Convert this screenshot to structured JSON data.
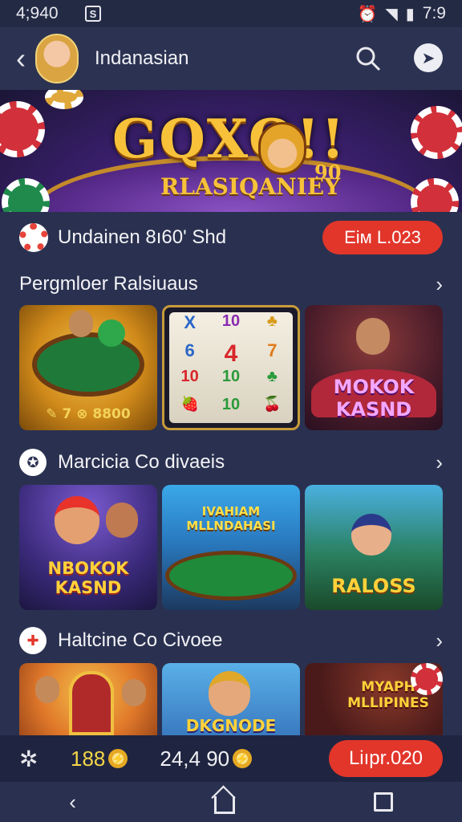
{
  "status_bar": {
    "time": "4;940",
    "notif_icon": "S",
    "clock": "7:9"
  },
  "app_bar": {
    "title": "Indanasian"
  },
  "banner": {
    "logo_text": "GQXO!!",
    "logo_sub": "RLASIQANIEY",
    "logo_small": "90"
  },
  "promo": {
    "text": "Undainen 8ı60' Shd",
    "button_label": "Eiм L.023"
  },
  "sections": [
    {
      "title": "Pergmloer Ralsiuaus",
      "tiles": [
        {
          "caption": "✎ 7 ⊗ 8800",
          "caption_color": "#f3d35a"
        },
        {
          "caption": "",
          "caption_color": "#ffffff"
        },
        {
          "caption": "MOKOK KASND",
          "caption_color": "#f3a7ff"
        }
      ]
    },
    {
      "title": "Marcicia Co divaeis",
      "tiles": [
        {
          "caption": "NBOKOK KASND",
          "caption_color": "#ffd23a"
        },
        {
          "caption": "IVAHIAM MLLNDAHASI",
          "caption_color": "#ffe04a"
        },
        {
          "caption": "RALOSS",
          "caption_color": "#ffd23a"
        }
      ]
    },
    {
      "title": "Haltcine Co Civoee",
      "tiles": [
        {
          "caption": "",
          "caption_color": "#ffffff"
        },
        {
          "caption": "DKGNODE",
          "caption_color": "#ffd23a"
        },
        {
          "caption": "MYAPH MLLIPINES",
          "caption_color": "#ffd23a"
        }
      ]
    }
  ],
  "slot_symbols": [
    "X",
    "10",
    "♣",
    "6",
    "4",
    "7",
    "10",
    "10",
    "♣",
    "🍓",
    "10",
    "🍒"
  ],
  "bottom_bar": {
    "coins": "188",
    "balance": "24,4 90",
    "button_label": "Liıpr.020"
  }
}
